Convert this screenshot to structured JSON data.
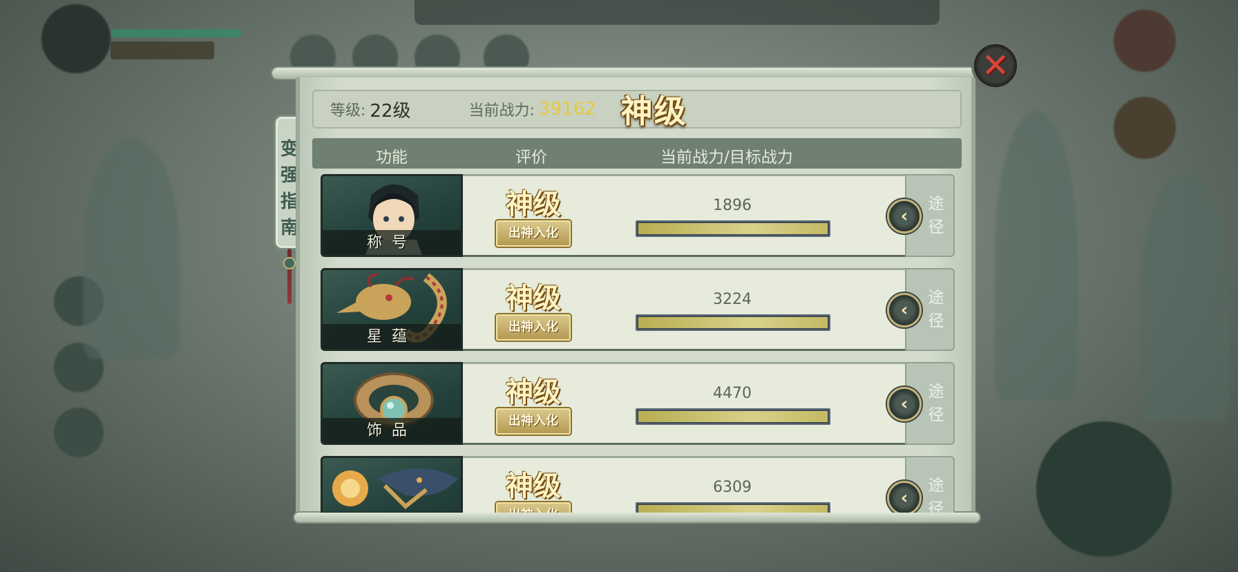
{
  "side_tag": {
    "chars": [
      "变",
      "强",
      "指",
      "南"
    ]
  },
  "info": {
    "level_label": "等级:",
    "level_value": "22级",
    "power_label": "当前战力:",
    "power_value": "39162",
    "grade": "神级"
  },
  "columns": {
    "function": "功能",
    "rating": "评价",
    "progress": "当前战力/目标战力"
  },
  "rows": [
    {
      "label": "称号",
      "grade": "神级",
      "badge": "出神入化",
      "value": "1896",
      "progress": 1.0,
      "route": "途径",
      "icon": "hero-portrait-icon"
    },
    {
      "label": "星蕴",
      "grade": "神级",
      "badge": "出神入化",
      "value": "3224",
      "progress": 1.0,
      "route": "途径",
      "icon": "dragon-icon"
    },
    {
      "label": "饰品",
      "grade": "神级",
      "badge": "出神入化",
      "value": "4470",
      "progress": 1.0,
      "route": "途径",
      "icon": "bracelet-icon"
    },
    {
      "label": "",
      "grade": "神级",
      "badge": "出神入化",
      "value": "6309",
      "progress": 1.0,
      "route": "途径",
      "icon": "dragon-pearl-icon"
    }
  ],
  "close_icon": "close-x-icon",
  "colors": {
    "power_value": "#e7c83c",
    "grade_gold": "#fff3c2",
    "close_red": "#d9453b"
  }
}
